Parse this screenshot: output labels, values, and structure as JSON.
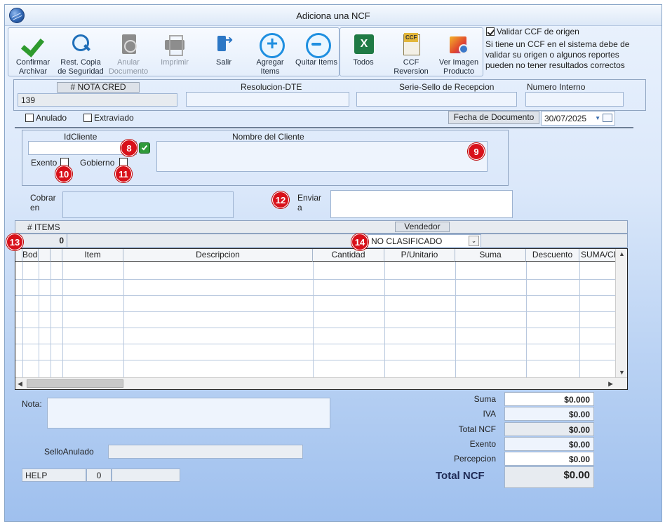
{
  "window": {
    "title": "Adiciona una NCF"
  },
  "toolbar": {
    "confirm_label": "Confirmar Archivar",
    "restore_label": "Rest. Copia de Seguridad",
    "void_label": "Anular Documento",
    "print_label": "Imprimir",
    "exit_label": "Salir",
    "add_items_label": "Agregar Items",
    "remove_items_label": "Quitar Items",
    "all_label": "Todos",
    "ccf_reversal_label": "CCF Reversion",
    "view_image_label": "Ver Imagen Producto"
  },
  "validate": {
    "label": "Validar CCF de origen",
    "checked": true,
    "note": "Si tiene un CCF en el sistema debe de validar su origen o algunos reportes pueden no tener resultados correctos"
  },
  "header_fields": {
    "nota_cred_label": "# NOTA CRED",
    "nota_cred_value": "139",
    "resolucion_label": "Resolucion-DTE",
    "resolucion_value": "",
    "serie_label": "Serie-Sello de Recepcion",
    "serie_value": "",
    "numero_interno_label": "Numero Interno",
    "numero_interno_value": ""
  },
  "status": {
    "anulado_label": "Anulado",
    "extraviado_label": "Extraviado"
  },
  "fecha": {
    "label": "Fecha de  Documento",
    "value": "30/07/2025"
  },
  "client": {
    "id_label": "IdCliente",
    "id_value": "",
    "name_label": "Nombre del Cliente",
    "name_value": "",
    "exento_label": "Exento",
    "gobierno_label": "Gobierno"
  },
  "cobrar": {
    "label": "Cobrar en",
    "value": ""
  },
  "enviar": {
    "label": "Enviar a",
    "value": ""
  },
  "items_bar": {
    "items_label": "# ITEMS",
    "items_count": "0",
    "vendedor_label": "Vendedor",
    "vendedor_value": "NO CLASIFICADO"
  },
  "grid": {
    "columns": [
      "Bodega",
      "",
      "",
      "Item",
      "Descripcion",
      "Cantidad",
      "P/Unitario",
      "Suma",
      "Descuento",
      "SUMA/CD"
    ]
  },
  "nota": {
    "label": "Nota:",
    "value": ""
  },
  "sello": {
    "label": "SelloAnulado",
    "value": ""
  },
  "help": {
    "label": "HELP",
    "count": "0",
    "extra": ""
  },
  "totals": {
    "suma_label": "Suma",
    "suma_value": "$0.000",
    "iva_label": "IVA",
    "iva_value": "$0.00",
    "total_ncf_label": "Total NCF",
    "total_ncf_value": "$0.00",
    "exento_label": "Exento",
    "exento_value": "$0.00",
    "percepcion_label": "Percepcion",
    "percepcion_value": "$0.00",
    "grand_label": "Total NCF",
    "grand_value": "$0.00"
  },
  "badges": {
    "b8": "8",
    "b9": "9",
    "b10": "10",
    "b11": "11",
    "b12": "12",
    "b13": "13",
    "b14": "14"
  },
  "colors": {
    "badge": "#d8111a",
    "accent": "#1e8fe0"
  }
}
